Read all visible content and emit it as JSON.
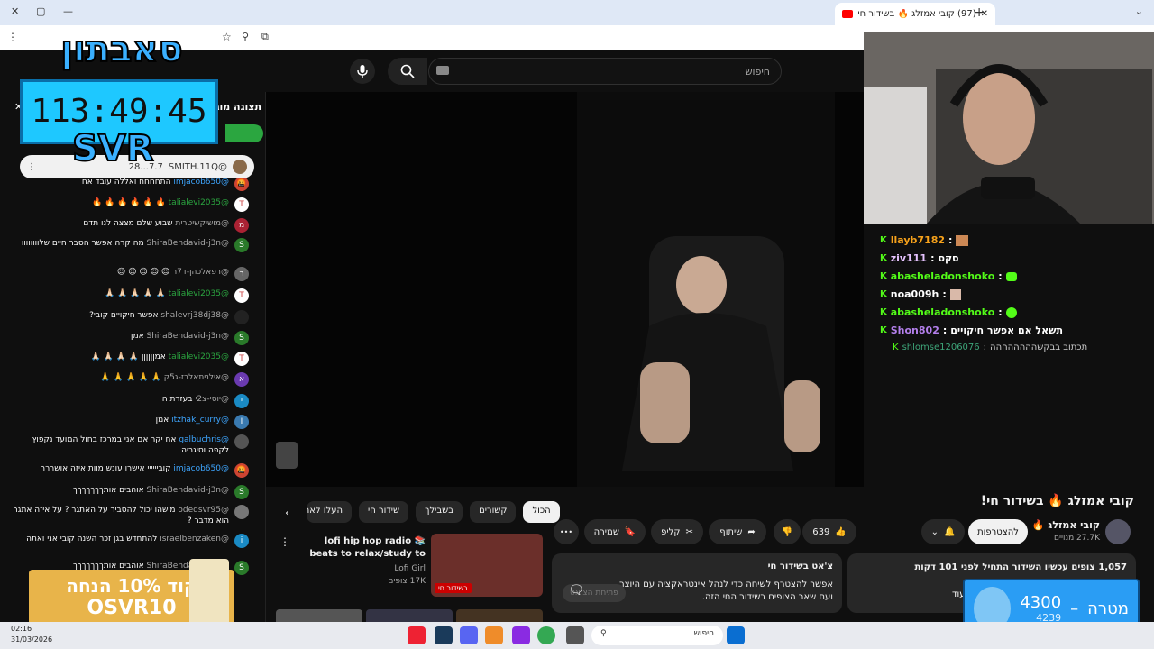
{
  "browser": {
    "tab_title": "(97) קובי אמזלג 🔥 בשידור חי!",
    "new_tab": "+",
    "window_controls": [
      "—",
      "▢",
      "✕"
    ]
  },
  "yt": {
    "search_placeholder": "חיפוש",
    "video_title": "קובי אמזלג 🔥 בשידור חי!",
    "channel_name": "קובי אמזלג 🔥",
    "subscribers": "27.7K מנויים",
    "join_label": "להצטרפות",
    "likes": "639",
    "share_label": "שיתוף",
    "clip_label": "קליפ",
    "save_label": "שמירה",
    "more_label": "•••",
    "chips": [
      "הכול",
      "קשורים",
      "בשבילך",
      "שידור חי",
      "העלו לאחרונה"
    ],
    "desc_stats": "1,057 צופים עכשיו  השידור התחיל לפני 101 דקות",
    "desc_more": "...עוד",
    "livechat_title": "צ'אט בשידור חי",
    "livechat_text": "אפשר להצטרף לשיחה כדי לנהל אינטראקציה עם היוצר ועם שאר הצופים בשידור החי הזה.",
    "livechat_btn": "פתיחת הצ'אט",
    "rec_title": "lofi hip hop radio 📚 beats to relax/study to",
    "rec_channel": "Lofi Girl",
    "rec_views": "17K צופים",
    "rec_badge": "בשידור חי"
  },
  "chat": {
    "header": "תצוגה מוגבלת",
    "pinned_author": "@SMITH.11Q",
    "pinned_text": "7.7...28",
    "messages": [
      {
        "author": "@imjacob650",
        "text": "התחחחח ואללה עובד אח",
        "color": "blue",
        "avatar": "🤬",
        "avc": "#c43"
      },
      {
        "author": "@talialevi2035",
        "text": "🔥 🔥 🔥 🔥 🔥 🔥",
        "color": "green",
        "avatar": "T",
        "avc": "#fff"
      },
      {
        "author": "@מושיקשיטרית",
        "text": "שבוע שלם מצצה לנו תדם",
        "color": "",
        "avatar": "מ",
        "avc": "#a23"
      },
      {
        "author": "@ShiraBendavid-j3n",
        "text": "מה קרה אפשר הסבר חיים שלוווווווו",
        "color": "",
        "avatar": "S",
        "avc": "#2a7a2a"
      },
      {
        "author": "@רפאלכהן-ד7ר",
        "text": "😍 😍 😍 😍 😍",
        "color": "",
        "avatar": "ר",
        "avc": "#666"
      },
      {
        "author": "@talialevi2035",
        "text": "🙏🏻 🙏🏻 🙏🏻 🙏🏻 🙏🏻",
        "color": "green",
        "avatar": "T",
        "avc": "#fff"
      },
      {
        "author": "@shalevrj38dj38",
        "text": "אפשר חיקויים קובי?",
        "color": "",
        "avatar": "",
        "avc": "#222"
      },
      {
        "author": "@ShiraBendavid-j3n",
        "text": "אמן",
        "color": "",
        "avatar": "S",
        "avc": "#2a7a2a"
      },
      {
        "author": "@talialevi2035",
        "text": "אמןןןןןן 🙏🏻 🙏🏻 🙏🏻 🙏🏻",
        "color": "green",
        "avatar": "T",
        "avc": "#fff"
      },
      {
        "author": "@אילניתאלבז-ג5ק",
        "text": "🙏 🙏 🙏 🙏 🙏",
        "color": "",
        "avatar": "א",
        "avc": "#6a3ab0"
      },
      {
        "author": "@יוסי-צ2י",
        "text": "בעזרת ה",
        "color": "",
        "avatar": "י",
        "avc": "#1a8ac4"
      },
      {
        "author": "@itzhak_curry",
        "text": "אמן",
        "color": "blue",
        "avatar": "I",
        "avc": "#3a7ab0"
      },
      {
        "author": "@galbuchris",
        "text": "אח יקר אם אני במרכז בחול המועד נקפוץ לקפה וסיגריה",
        "color": "blue",
        "avatar": "",
        "avc": "#555"
      },
      {
        "author": "@imjacob650",
        "text": "קוביייייי אישרו עונש מוות איזה אושררר",
        "color": "blue",
        "avatar": "🤬",
        "avc": "#c43"
      },
      {
        "author": "@ShiraBendavid-j3n",
        "text": "אוהבים אותךךךךךךך",
        "color": "",
        "avatar": "S",
        "avc": "#2a7a2a"
      },
      {
        "author": "@odedsvr95",
        "text": "מישהו יכול להסביר על האתגר ? על איזה אתגר הוא מדבר ?",
        "color": "",
        "avatar": "",
        "avc": "#777"
      },
      {
        "author": "@israelbenzaken",
        "text": "להתחדש בגן זכר השנה קובי אני ואתה",
        "color": "",
        "avatar": "i",
        "avc": "#1a8ac4"
      },
      {
        "author": "@ShiraBendavid-j3n",
        "text": "אוהבים אותךךךךךךך",
        "color": "",
        "avatar": "S",
        "avc": "#2a7a2a"
      }
    ]
  },
  "overlay": {
    "logo": "סאבתון",
    "timer": "113:49:45",
    "svr": "SVR",
    "promo_line1": "קוד 10% הנחה",
    "promo_line2": "OSVR10",
    "goal_label": "מטרה",
    "goal_value": "4300",
    "goal_current": "4239",
    "goal_sep": "–"
  },
  "kick": {
    "lines": [
      {
        "user": "llayb7182",
        "text": "",
        "ucolor": "#f7a21b"
      },
      {
        "user": "ziv111",
        "text": "סקס",
        "ucolor": "#e6c3ff"
      },
      {
        "user": "abasheladonshoko",
        "text": "",
        "ucolor": "#53fc18"
      },
      {
        "user": "noa009h",
        "text": "",
        "ucolor": "#fff"
      },
      {
        "user": "abasheladonshoko",
        "text": "",
        "ucolor": "#53fc18"
      },
      {
        "user": "Shon802",
        "text": "תשאל אם אפשר חיקויים",
        "ucolor": "#b37feb"
      },
      {
        "user": "shlomse1206076",
        "text": "תכתוב בבקשהההההההה",
        "ucolor": "#3ea67a"
      }
    ]
  },
  "taskbar": {
    "time": "02:16",
    "date": "31/03/2026",
    "search": "חיפוש"
  }
}
